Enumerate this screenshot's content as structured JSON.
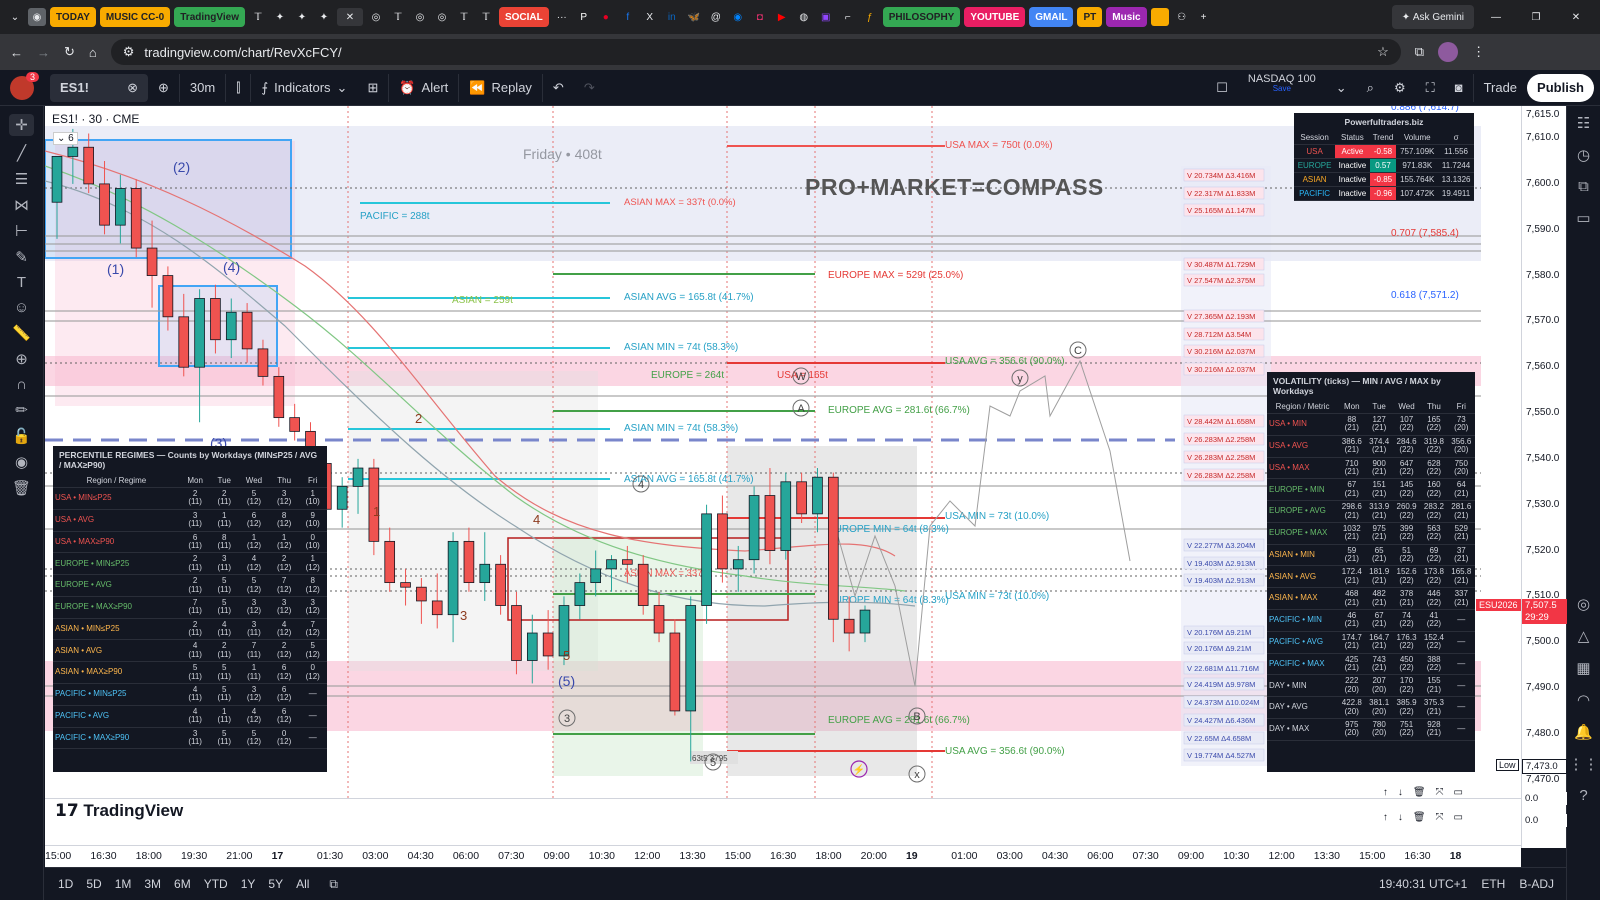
{
  "browser": {
    "tabs": [
      "TODAY",
      "MUSIC CC-0",
      "TradingView",
      "SOCIAL",
      "PHILOSOPHY",
      "YOUTUBE",
      "GMAIL",
      "PT",
      "Music"
    ],
    "tab_colors": [
      "#f9ab00",
      "#f9ab00",
      "#34a853",
      "#ea4335",
      "#34a853",
      "#e91e63",
      "#4285f4",
      "#f9ab00",
      "#9c27b0"
    ],
    "url": "tradingview.com/chart/RevXcFCY/",
    "ask_gemini": "Ask Gemini"
  },
  "toolbar": {
    "symbol": "ES1!",
    "interval": "30m",
    "indicators": "Indicators",
    "alert": "Alert",
    "replay": "Replay",
    "compare_symbol": "NASDAQ 100",
    "compare_sub": "Save",
    "trade": "Trade",
    "publish": "Publish",
    "notif_count": "3"
  },
  "legend": {
    "symbol_line": "ES1! · 30 · CME",
    "collapse_count": "6",
    "watermark_title": "PRO+MARKET=COMPASS",
    "friday_label": "Friday • 408t"
  },
  "levels": {
    "usa_max": "USA MAX = 750t (0.0%)",
    "asian_max": "ASIAN MAX = 337t (0.0%)",
    "pacific": "PACIFIC = 288t",
    "europe_max": "EUROPE MAX = 529t (25.0%)",
    "asian_avg_left": "ASIAN = 259t",
    "asian_avg": "ASIAN AVG = 165.8t (41.7%)",
    "asian_min": "ASIAN MIN = 74t (58.3%)",
    "europe_mid": "EUROPE = 264t",
    "usa_mid": "USA = 165t",
    "usa_avg": "USA AVG = 356.6t (90.0%)",
    "europe_avg": "EUROPE AVG = 281.6t (66.7%)",
    "asian_min2": "ASIAN MIN = 74t (58.3%)",
    "asian_avg2": "ASIAN AVG = 165.8t (41.7%)",
    "europe_min": "EUROPE MIN = 64t (8.3%)",
    "usa_min": "USA MIN = 73t (10.0%)",
    "asian_max2": "ASIAN MAX = 337t",
    "europe_min2": "EUROPE MIN = 64t (8.3%)",
    "usa_min2": "USA MIN = 73t (10.0%)",
    "europe_avg2": "EUROPE AVG = 281.6t (66.7%)",
    "usa_avg2": "USA AVG = 356.6t (90.0%)",
    "fib_886": "0.886 (7,614.7)",
    "fib_707": "0.707 (7,585.4)",
    "fib_618": "0.618 (7,571.2)",
    "bottom_box": "63t5 3795"
  },
  "wave_labels": {
    "w1": "(1)",
    "w2": "(2)",
    "w4": "(4)",
    "w3": "(3)",
    "w5": "(5)",
    "n1": "1",
    "n2": "2",
    "n3": "3",
    "n4": "4",
    "n5": "5",
    "c4": "4",
    "c3": "3",
    "c5": "5",
    "A": "A",
    "B": "B",
    "C": "C",
    "W": "W",
    "X": "x",
    "Y": "y"
  },
  "volume_labels": [
    "V 20.734M  Δ3.416M",
    "V 22.317M  Δ1.833M",
    "V 25.165M  Δ1.147M",
    "V 30.487M  Δ1.729M",
    "V 27.547M  Δ2.375M",
    "V 27.365M  Δ2.193M",
    "V 28.712M  Δ3.54M",
    "V 30.216M  Δ2.037M",
    "V 30.216M  Δ2.037M",
    "V 28.442M  Δ1.658M",
    "V 26.283M  Δ2.258M",
    "V 26.283M  Δ2.258M",
    "V 26.283M  Δ2.258M",
    "V 22.277M  Δ3.204M",
    "V 19.403M  Δ2.913M",
    "V 19.403M  Δ2.913M",
    "V 20.176M  Δ9.21M",
    "V 20.176M  Δ9.21M",
    "V 22.681M  Δ11.716M",
    "V 24.419M  Δ9.978M",
    "V 24.373M  Δ10.024M",
    "V 24.427M  Δ6.436M",
    "V 22.65M  Δ4.658M",
    "V 19.774M  Δ4.527M"
  ],
  "session_table": {
    "title": "Powerfultraders.biz",
    "headers": [
      "Session",
      "Status",
      "Trend",
      "Volume",
      "σ"
    ],
    "rows": [
      [
        "USA",
        "Active",
        "-0.58",
        "757.109K",
        "11.556"
      ],
      [
        "EUROPE",
        "Inactive",
        "0.57",
        "971.83K",
        "11.7244"
      ],
      [
        "ASIAN",
        "Inactive",
        "-0.85",
        "155.764K",
        "13.1326"
      ],
      [
        "PACIFIC",
        "Inactive",
        "-0.96",
        "107.472K",
        "19.4911"
      ]
    ]
  },
  "percentile_table": {
    "title": "PERCENTILE REGIMES — Counts by Workdays (MIN≤P25 / AVG / MAX≥P90)",
    "headers": [
      "Region / Regime",
      "Mon",
      "Tue",
      "Wed",
      "Thu",
      "Fri"
    ],
    "rows": [
      [
        "USA • MIN≤P25",
        "2\n(11)",
        "2\n(11)",
        "5\n(12)",
        "3\n(12)",
        "1\n(10)"
      ],
      [
        "USA • AVG",
        "3\n(11)",
        "1\n(11)",
        "6\n(12)",
        "8\n(12)",
        "9\n(10)"
      ],
      [
        "USA • MAX≥P90",
        "6\n(11)",
        "8\n(11)",
        "1\n(12)",
        "1\n(12)",
        "0\n(10)"
      ],
      [
        "EUROPE • MIN≤P25",
        "2\n(11)",
        "3\n(11)",
        "4\n(12)",
        "2\n(12)",
        "1\n(12)"
      ],
      [
        "EUROPE • AVG",
        "2\n(11)",
        "5\n(11)",
        "5\n(12)",
        "7\n(12)",
        "8\n(12)"
      ],
      [
        "EUROPE • MAX≥P90",
        "7\n(11)",
        "5\n(11)",
        "3\n(12)",
        "3\n(12)",
        "3\n(12)"
      ],
      [
        "ASIAN • MIN≤P25",
        "2\n(11)",
        "4\n(11)",
        "3\n(11)",
        "4\n(12)",
        "7\n(12)"
      ],
      [
        "ASIAN • AVG",
        "4\n(11)",
        "2\n(11)",
        "7\n(11)",
        "2\n(12)",
        "5\n(12)"
      ],
      [
        "ASIAN • MAX≥P90",
        "5\n(11)",
        "5\n(11)",
        "1\n(11)",
        "6\n(12)",
        "0\n(12)"
      ],
      [
        "PACIFIC • MIN≤P25",
        "4\n(11)",
        "5\n(11)",
        "3\n(12)",
        "6\n(12)",
        "—"
      ],
      [
        "PACIFIC • AVG",
        "4\n(11)",
        "1\n(11)",
        "4\n(12)",
        "6\n(12)",
        "—"
      ],
      [
        "PACIFIC • MAX≥P90",
        "3\n(11)",
        "5\n(11)",
        "5\n(12)",
        "0\n(12)",
        "—"
      ]
    ]
  },
  "volatility_table": {
    "title": "VOLATILITY (ticks) — MIN / AVG / MAX by Workdays",
    "headers": [
      "Region / Metric",
      "Mon",
      "Tue",
      "Wed",
      "Thu",
      "Fri"
    ],
    "rows": [
      [
        "USA • MIN",
        "88\n(21)",
        "127\n(21)",
        "107\n(22)",
        "165\n(22)",
        "73\n(20)"
      ],
      [
        "USA • AVG",
        "386.6\n(21)",
        "374.4\n(21)",
        "284.6\n(22)",
        "319.8\n(22)",
        "356.6\n(20)"
      ],
      [
        "USA • MAX",
        "710\n(21)",
        "900\n(21)",
        "647\n(22)",
        "628\n(22)",
        "750\n(20)"
      ],
      [
        "EUROPE • MIN",
        "67\n(21)",
        "151\n(21)",
        "145\n(22)",
        "160\n(22)",
        "64\n(21)"
      ],
      [
        "EUROPE • AVG",
        "298.6\n(21)",
        "313.9\n(21)",
        "260.9\n(22)",
        "283.2\n(22)",
        "281.6\n(21)"
      ],
      [
        "EUROPE • MAX",
        "1032\n(21)",
        "975\n(21)",
        "399\n(22)",
        "563\n(22)",
        "529\n(21)"
      ],
      [
        "ASIAN • MIN",
        "59\n(21)",
        "65\n(21)",
        "51\n(22)",
        "69\n(22)",
        "37\n(21)"
      ],
      [
        "ASIAN • AVG",
        "172.4\n(21)",
        "181.9\n(21)",
        "152.6\n(22)",
        "173.8\n(22)",
        "165.8\n(21)"
      ],
      [
        "ASIAN • MAX",
        "468\n(21)",
        "482\n(21)",
        "378\n(21)",
        "446\n(22)",
        "337\n(21)"
      ],
      [
        "PACIFIC • MIN",
        "46\n(21)",
        "67\n(21)",
        "74\n(22)",
        "41\n(22)",
        "—"
      ],
      [
        "PACIFIC • AVG",
        "174.7\n(21)",
        "164.7\n(21)",
        "176.3\n(22)",
        "152.4\n(22)",
        "—"
      ],
      [
        "PACIFIC • MAX",
        "425\n(21)",
        "743\n(21)",
        "450\n(22)",
        "388\n(22)",
        "—"
      ],
      [
        "DAY • MIN",
        "222\n(20)",
        "207\n(20)",
        "170\n(22)",
        "155\n(21)",
        "—"
      ],
      [
        "DAY • AVG",
        "422.8\n(20)",
        "381.1\n(20)",
        "385.9\n(22)",
        "375.3\n(21)",
        "—"
      ],
      [
        "DAY • MAX",
        "975\n(20)",
        "780\n(20)",
        "751\n(22)",
        "928\n(21)",
        "—"
      ]
    ]
  },
  "price_axis": {
    "ticks": [
      "7,615.0",
      "7,610.0",
      "7,600.0",
      "7,590.0",
      "7,580.0",
      "7,570.0",
      "7,560.0",
      "7,550.0",
      "7,540.0",
      "7,530.0",
      "7,520.0",
      "7,510.0",
      "7,500.0",
      "7,490.0",
      "7,480.0",
      "7,470.0"
    ],
    "current_symbol": "ESU2026",
    "current_price": "7,507.5",
    "countdown": "29:29",
    "low_label": "Low",
    "low_price": "7,473.0",
    "sub_values": [
      "0.0",
      "0.0"
    ]
  },
  "time_axis": {
    "ticks": [
      "15:00",
      "16:30",
      "18:00",
      "19:30",
      "21:00",
      "17",
      "01:30",
      "03:00",
      "04:30",
      "06:00",
      "07:30",
      "09:00",
      "10:30",
      "12:00",
      "13:30",
      "15:00",
      "16:30",
      "18:00",
      "20:00",
      "19",
      "01:00",
      "03:00",
      "04:30",
      "06:00",
      "07:30",
      "09:00",
      "10:30",
      "12:00",
      "13:30",
      "15:00",
      "16:30",
      "18"
    ]
  },
  "bottom_bar": {
    "ranges": [
      "1D",
      "5D",
      "1M",
      "3M",
      "6M",
      "YTD",
      "1Y",
      "5Y",
      "All"
    ],
    "clock": "19:40:31 UTC+1",
    "session": "ETH",
    "adj": "B-ADJ"
  },
  "logo_text": "TradingView",
  "colors": {
    "up": "#26a69a",
    "down": "#ef5350",
    "accent": "#2962ff",
    "table_bg": "#131722"
  },
  "chart_data": {
    "type": "candlestick",
    "symbol": "ES1!",
    "interval": "30m",
    "candles": [
      {
        "o": 7596,
        "h": 7606,
        "l": 7588,
        "c": 7606
      },
      {
        "o": 7606,
        "h": 7612,
        "l": 7600,
        "c": 7608
      },
      {
        "o": 7608,
        "h": 7611,
        "l": 7598,
        "c": 7600
      },
      {
        "o": 7600,
        "h": 7605,
        "l": 7589,
        "c": 7591
      },
      {
        "o": 7591,
        "h": 7602,
        "l": 7587,
        "c": 7599
      },
      {
        "o": 7599,
        "h": 7601,
        "l": 7584,
        "c": 7586
      },
      {
        "o": 7586,
        "h": 7592,
        "l": 7573,
        "c": 7580
      },
      {
        "o": 7580,
        "h": 7582,
        "l": 7568,
        "c": 7571
      },
      {
        "o": 7571,
        "h": 7576,
        "l": 7558,
        "c": 7560
      },
      {
        "o": 7560,
        "h": 7577,
        "l": 7548,
        "c": 7575
      },
      {
        "o": 7575,
        "h": 7578,
        "l": 7563,
        "c": 7566
      },
      {
        "o": 7566,
        "h": 7575,
        "l": 7562,
        "c": 7572
      },
      {
        "o": 7572,
        "h": 7574,
        "l": 7561,
        "c": 7564
      },
      {
        "o": 7564,
        "h": 7566,
        "l": 7556,
        "c": 7558
      },
      {
        "o": 7558,
        "h": 7560,
        "l": 7547,
        "c": 7549
      },
      {
        "o": 7549,
        "h": 7552,
        "l": 7544,
        "c": 7546
      },
      {
        "o": 7546,
        "h": 7548,
        "l": 7538,
        "c": 7539
      },
      {
        "o": 7539,
        "h": 7541,
        "l": 7527,
        "c": 7529
      },
      {
        "o": 7529,
        "h": 7536,
        "l": 7525,
        "c": 7534
      },
      {
        "o": 7534,
        "h": 7540,
        "l": 7528,
        "c": 7538
      },
      {
        "o": 7538,
        "h": 7540,
        "l": 7519,
        "c": 7522
      },
      {
        "o": 7522,
        "h": 7525,
        "l": 7511,
        "c": 7513
      },
      {
        "o": 7513,
        "h": 7516,
        "l": 7508,
        "c": 7512
      },
      {
        "o": 7512,
        "h": 7514,
        "l": 7504,
        "c": 7509
      },
      {
        "o": 7509,
        "h": 7515,
        "l": 7503,
        "c": 7506
      },
      {
        "o": 7506,
        "h": 7524,
        "l": 7500,
        "c": 7522
      },
      {
        "o": 7522,
        "h": 7525,
        "l": 7511,
        "c": 7513
      },
      {
        "o": 7513,
        "h": 7524,
        "l": 7509,
        "c": 7517
      },
      {
        "o": 7517,
        "h": 7519,
        "l": 7506,
        "c": 7508
      },
      {
        "o": 7508,
        "h": 7511,
        "l": 7493,
        "c": 7496
      },
      {
        "o": 7496,
        "h": 7506,
        "l": 7491,
        "c": 7502
      },
      {
        "o": 7502,
        "h": 7507,
        "l": 7494,
        "c": 7497
      },
      {
        "o": 7497,
        "h": 7510,
        "l": 7495,
        "c": 7508
      },
      {
        "o": 7508,
        "h": 7515,
        "l": 7505,
        "c": 7513
      },
      {
        "o": 7513,
        "h": 7520,
        "l": 7510,
        "c": 7516
      },
      {
        "o": 7516,
        "h": 7519,
        "l": 7511,
        "c": 7518
      },
      {
        "o": 7518,
        "h": 7521,
        "l": 7513,
        "c": 7517
      },
      {
        "o": 7517,
        "h": 7519,
        "l": 7506,
        "c": 7508
      },
      {
        "o": 7508,
        "h": 7511,
        "l": 7500,
        "c": 7502
      },
      {
        "o": 7502,
        "h": 7505,
        "l": 7484,
        "c": 7485
      },
      {
        "o": 7485,
        "h": 7510,
        "l": 7474,
        "c": 7508
      },
      {
        "o": 7508,
        "h": 7530,
        "l": 7504,
        "c": 7528
      },
      {
        "o": 7528,
        "h": 7532,
        "l": 7513,
        "c": 7516
      },
      {
        "o": 7516,
        "h": 7521,
        "l": 7511,
        "c": 7518
      },
      {
        "o": 7518,
        "h": 7534,
        "l": 7515,
        "c": 7532
      },
      {
        "o": 7532,
        "h": 7538,
        "l": 7517,
        "c": 7520
      },
      {
        "o": 7520,
        "h": 7537,
        "l": 7518,
        "c": 7535
      },
      {
        "o": 7535,
        "h": 7537,
        "l": 7526,
        "c": 7528
      },
      {
        "o": 7528,
        "h": 7538,
        "l": 7524,
        "c": 7536
      },
      {
        "o": 7536,
        "h": 7537,
        "l": 7500,
        "c": 7505
      },
      {
        "o": 7505,
        "h": 7510,
        "l": 7498,
        "c": 7502
      },
      {
        "o": 7502,
        "h": 7508,
        "l": 7500,
        "c": 7507
      }
    ],
    "ylim": [
      7466,
      7617
    ]
  }
}
